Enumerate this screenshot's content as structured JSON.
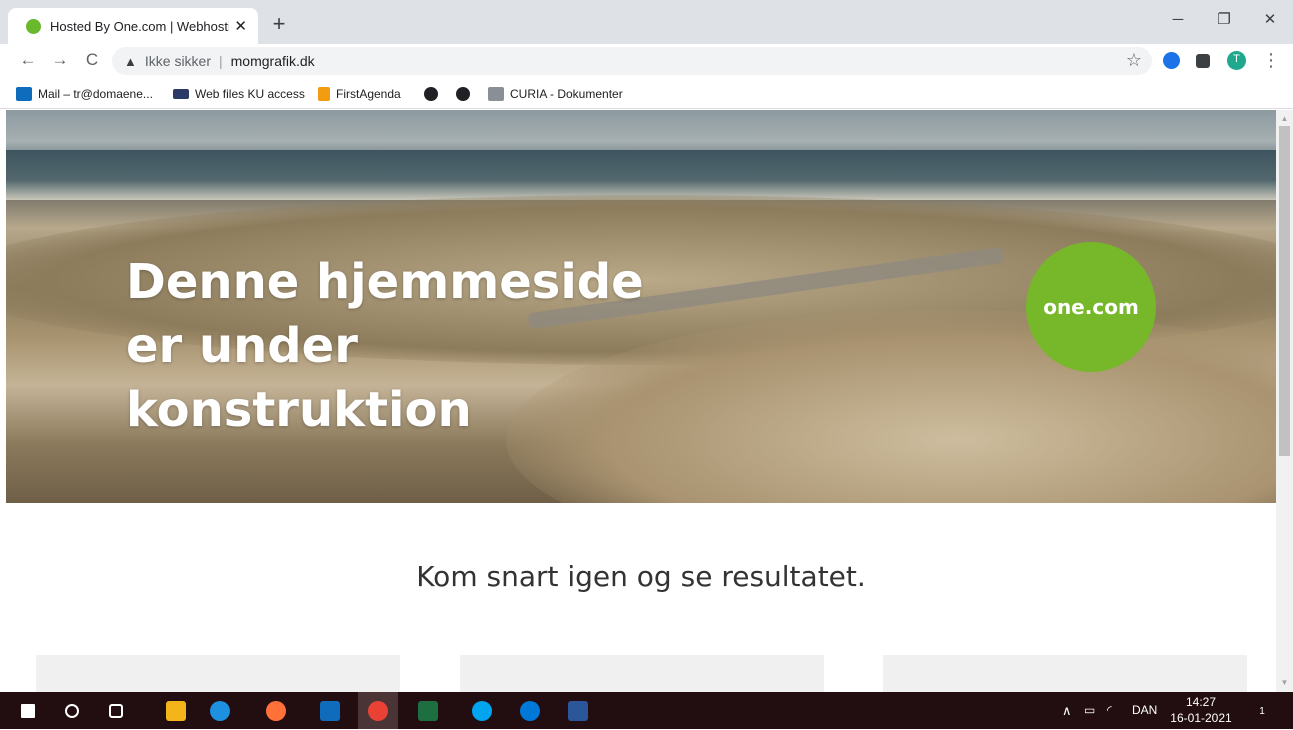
{
  "tab": {
    "title": "Hosted By One.com | Webhosting",
    "close": "✕"
  },
  "newtab": "+",
  "window": {
    "minimize": "─",
    "restore": "❐",
    "close": "✕"
  },
  "nav": {
    "back": "←",
    "forward": "→",
    "reload": "C"
  },
  "omnibox": {
    "warning_icon": "▲",
    "security": "Ikke sikker",
    "separator": "|",
    "url": "momgrafik.dk"
  },
  "toolbar": {
    "star": "☆",
    "profile": "T",
    "menu": "⋮"
  },
  "bookmarks": [
    {
      "label": "Mail – tr@domaene...",
      "color": "#0f6cbd"
    },
    {
      "label": "Web files KU access",
      "color": "#2b3a67"
    },
    {
      "label": "FirstAgenda",
      "color": "#f39c12"
    },
    {
      "label": "",
      "color": "#202124"
    },
    {
      "label": "",
      "color": "#202124"
    },
    {
      "label": "CURIA - Dokumenter",
      "color": "#8a8f96"
    }
  ],
  "hero": {
    "title": "Denne hjemmeside er under konstruktion",
    "badge_text": "one.com",
    "badge_color": "#76b82a"
  },
  "tagline": "Kom snart igen og se resultatet.",
  "taskbar": {
    "apps": [
      "windows-start",
      "search",
      "task-view",
      "file-explorer",
      "internet-explorer",
      "firefox",
      "outlook",
      "chrome",
      "excel",
      "skype-business",
      "skype",
      "word"
    ],
    "tray_lang": "DAN",
    "time": "14:27",
    "date": "16-01-2021",
    "notification_count": "1"
  }
}
